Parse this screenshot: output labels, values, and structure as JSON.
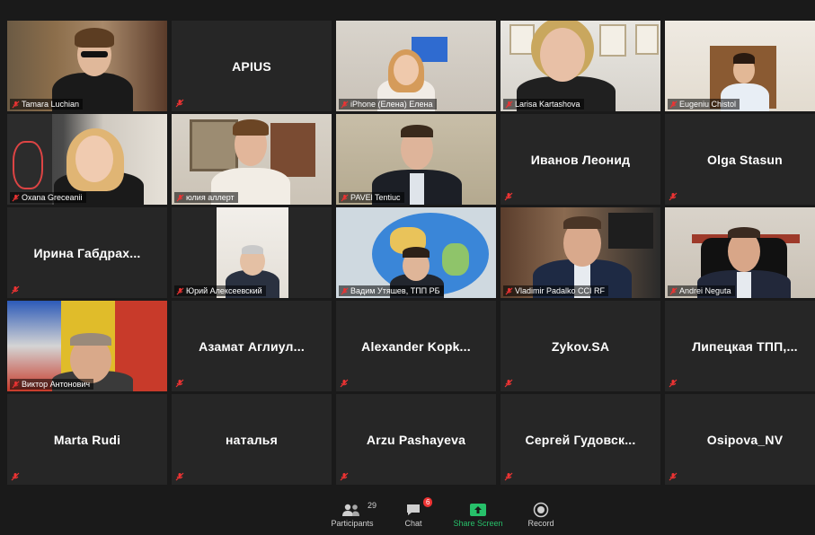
{
  "toolbar": {
    "participants_label": "Participants",
    "participants_count": "29",
    "chat_label": "Chat",
    "chat_badge": "6",
    "share_label": "Share Screen",
    "record_label": "Record"
  },
  "tiles": [
    {
      "name": "Tamara Luchian"
    },
    {
      "name": "APIUS"
    },
    {
      "name": "iPhone (Елена) Елена"
    },
    {
      "name": "Larisa Kartashova"
    },
    {
      "name": "Eugeniu Chistol"
    },
    {
      "name": "Oxana Greceanii"
    },
    {
      "name": "юлия аллерт"
    },
    {
      "name": "PAVEl Tentiuc"
    },
    {
      "name": "Иванов Леонид"
    },
    {
      "name": "Olga Stasun"
    },
    {
      "name": "Ирина Габдрах..."
    },
    {
      "name": "Юрий Алексеевский"
    },
    {
      "name": "Вадим Утяшев, ТПП РБ"
    },
    {
      "name": "Vladimir Padalko CCI RF"
    },
    {
      "name": "Andrei Neguta"
    },
    {
      "name": "Виктор Антонович"
    },
    {
      "name": "Азамат  Аглиул..."
    },
    {
      "name": "Alexander  Kopk..."
    },
    {
      "name": "Zykov.SA"
    },
    {
      "name": "Липецкая  ТПП,..."
    },
    {
      "name": "Marta Rudi"
    },
    {
      "name": "наталья"
    },
    {
      "name": "Arzu Pashayeva"
    },
    {
      "name": "Сергей  Гудовск..."
    },
    {
      "name": "Osipova_NV"
    }
  ]
}
